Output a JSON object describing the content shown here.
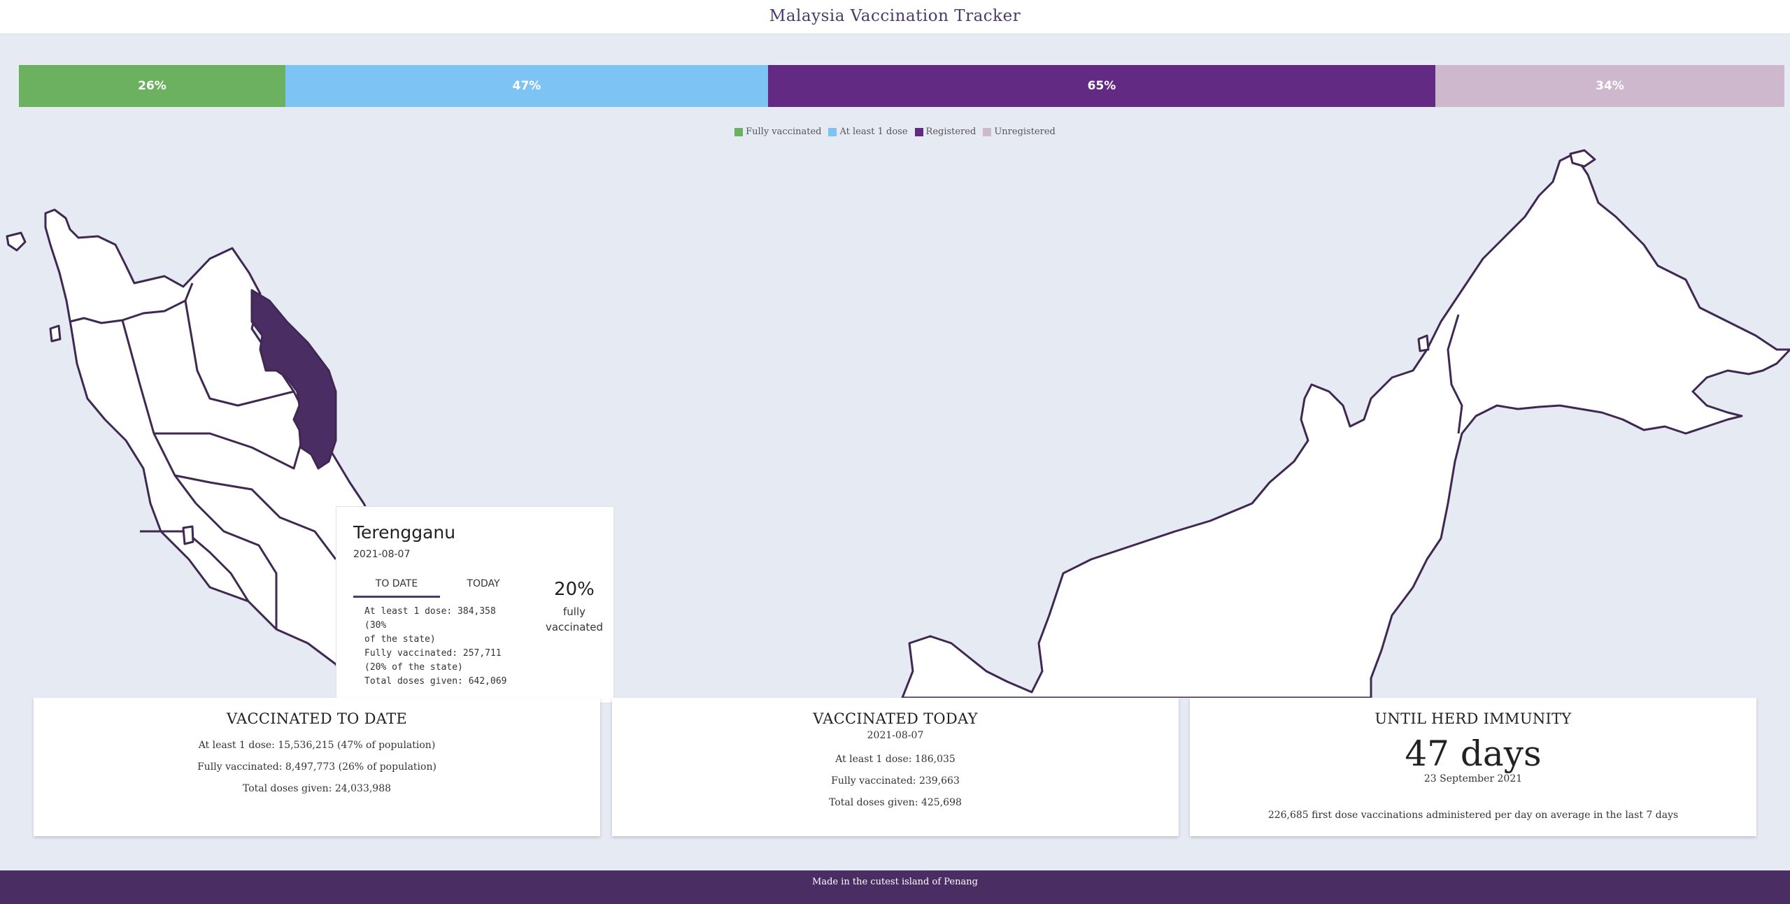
{
  "app": {
    "title": "Malaysia Vaccination Tracker"
  },
  "progress_bar": {
    "segments": [
      {
        "key": "fully",
        "label": "26%",
        "value": 26,
        "color": "#6bb15f"
      },
      {
        "key": "dose",
        "label": "47%",
        "value": 47,
        "color": "#7dc4f4"
      },
      {
        "key": "registered",
        "label": "65%",
        "value": 65,
        "color": "#632a83"
      },
      {
        "key": "unregistered",
        "label": "34%",
        "value": 34,
        "color": "#cdb8ce"
      }
    ]
  },
  "legend": {
    "items": [
      {
        "label": "Fully vaccinated",
        "color": "#6bb15f"
      },
      {
        "label": "At least 1 dose",
        "color": "#7dc4f4"
      },
      {
        "label": "Registered",
        "color": "#632a83"
      },
      {
        "label": "Unregistered",
        "color": "#cdb8ce"
      }
    ]
  },
  "map": {
    "highlighted_state": "Terengganu",
    "highlight_color": "#4a2d63",
    "tooltip": {
      "state": "Terengganu",
      "date": "2021-08-07",
      "tabs": [
        "TO DATE",
        "TODAY"
      ],
      "active_tab": "TO DATE",
      "stats_lines": [
        "At least 1 dose: 384,358 (30%",
        "of the state)",
        "Fully vaccinated: 257,711",
        "(20% of the state)",
        "Total doses given: 642,069"
      ],
      "percent": "20%",
      "percent_label_1": "fully",
      "percent_label_2": "vaccinated"
    }
  },
  "cards": {
    "to_date": {
      "title": "VACCINATED TO DATE",
      "line1": "At least 1 dose: 15,536,215 (47% of population)",
      "line2": "Fully vaccinated: 8,497,773 (26% of population)",
      "line3": "Total doses given: 24,033,988"
    },
    "today": {
      "title": "VACCINATED TODAY",
      "date": "2021-08-07",
      "line1": "At least 1 dose: 186,035",
      "line2": "Fully vaccinated: 239,663",
      "line3": "Total doses given: 425,698"
    },
    "herd": {
      "title": "UNTIL HERD IMMUNITY",
      "days": "47 days",
      "date": "23 September 2021",
      "note": "226,685 first dose vaccinations administered per day on average in the last 7 days"
    }
  },
  "footer": {
    "text": "Made in the cutest island of Penang"
  }
}
